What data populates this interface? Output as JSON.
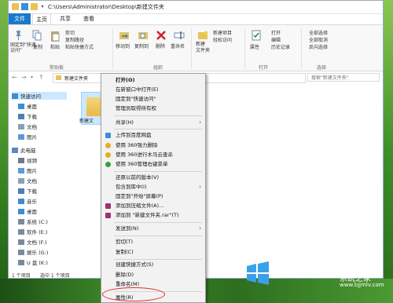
{
  "window": {
    "path": "C:\\Users\\Administrator\\Desktop\\新建文件夹",
    "tabs": [
      "文件",
      "主页",
      "共享",
      "查看"
    ]
  },
  "ribbon": {
    "pin_quick": "固定到\"快速访问\"",
    "copy": "复制",
    "paste": "粘贴",
    "copy_path": "复制路径",
    "paste_shortcut": "粘贴快捷方式",
    "cut": "剪切",
    "group_clipboard": "剪贴板",
    "move_to": "移动到",
    "copy_to": "复制到",
    "delete": "删除",
    "rename": "重命名",
    "group_organize": "组织",
    "new_folder": "新建\n文件夹",
    "new_item": "新建项目",
    "easy_access": "轻松访问",
    "properties": "属性",
    "open": "打开",
    "edit": "编辑",
    "history": "历史记录",
    "group_open": "打开",
    "select_all": "全部选择",
    "select_none": "全部取消",
    "invert_select": "反向选择",
    "group_select": "选择"
  },
  "address": {
    "crumb": "新建文件夹",
    "search_placeholder": "搜索\"新建文件夹\""
  },
  "sidebar": {
    "items": [
      "快速访问",
      "桌面",
      "下载",
      "文档",
      "图片",
      "此电脑",
      "视频",
      "图片",
      "文档",
      "下载",
      "音乐",
      "桌面",
      "系统 (C:)",
      "软件 (E:)",
      "文档 (F:)",
      "娱乐 (G:)",
      "U 盘 (K:)"
    ]
  },
  "content": {
    "folder_name": "新建文"
  },
  "status": {
    "count": "1 个项目",
    "selected": "选中 1 个项目"
  },
  "context_menu": {
    "items": [
      "打开(O)",
      "在新窗口中打开(E)",
      "固定到\"快速访问\"",
      "管理员取得所有权",
      "共享(H)",
      "上传到百度网盘",
      "使用 360强力删除",
      "使用 360进行木马云查杀",
      "使用 360管理右键菜单",
      "还原以前的版本(V)",
      "包含到库中(I)",
      "固定到\"开始\"屏幕(P)",
      "添加到压缩文件(A)...",
      "添加到 \"新建文件夹.rar\"(T)",
      "发送到(N)",
      "剪切(T)",
      "复制(C)",
      "创建快捷方式(S)",
      "删除(D)",
      "重命名(M)",
      "属性(R)"
    ]
  },
  "watermark": {
    "brand": "Windows",
    "sub": "系统之家",
    "url": "www.bjjmlv.com"
  }
}
